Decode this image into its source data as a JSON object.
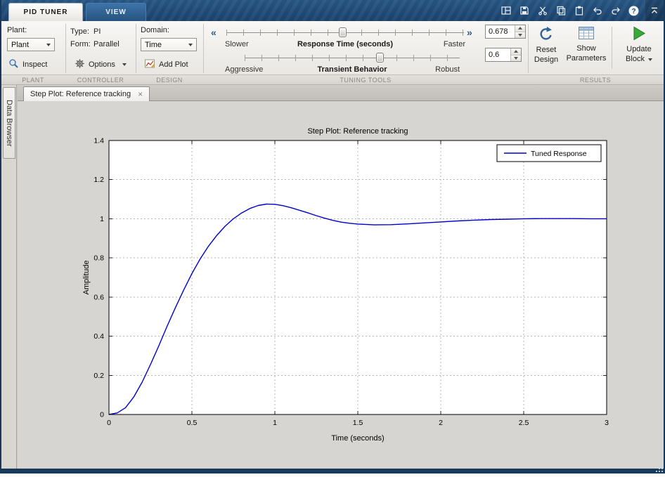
{
  "window": {
    "title_tabs": [
      {
        "label": "PID TUNER"
      },
      {
        "label": "VIEW"
      }
    ],
    "quick_access_icons": [
      "layout-grid-icon",
      "save-icon",
      "cut-icon",
      "copy-icon",
      "paste-icon",
      "undo-icon",
      "redo-icon",
      "help-icon"
    ],
    "collapse_ribbon_icon": "chevron-up-icon",
    "frame_color": "#16395c"
  },
  "ribbon": {
    "plant": {
      "section_label": "PLANT",
      "label": "Plant:",
      "dropdown_value": "Plant",
      "inspect_label": "Inspect"
    },
    "controller": {
      "section_label": "CONTROLLER",
      "type_label": "Type:",
      "type_value": "PI",
      "form_label": "Form:",
      "form_value": "Parallel",
      "options_label": "Options"
    },
    "design": {
      "section_label": "DESIGN",
      "domain_label": "Domain:",
      "domain_value": "Time",
      "add_plot_label": "Add Plot"
    },
    "tuning_tools": {
      "section_label": "TUNING TOOLS",
      "slower_chevron": "«",
      "faster_chevron": "»",
      "response_time": {
        "left": "Slower",
        "center": "Response Time (seconds)",
        "right": "Faster",
        "value": "0.678",
        "slider_percent": 49
      },
      "transient": {
        "left": "Aggressive",
        "center": "Transient Behavior",
        "right": "Robust",
        "value": "0.6",
        "slider_percent": 63
      }
    },
    "results": {
      "section_label": "RESULTS",
      "reset_design": {
        "line1": "Reset",
        "line2": "Design"
      },
      "show_parameters": {
        "line1": "Show",
        "line2": "Parameters"
      },
      "update_block": {
        "line1": "Update",
        "line2": "Block"
      }
    }
  },
  "sidebar": {
    "label": "Data Browser"
  },
  "document": {
    "tab_label": "Step Plot: Reference tracking",
    "close_icon": "×"
  },
  "chart_data": {
    "type": "line",
    "title": "Step Plot: Reference tracking",
    "xlabel": "Time (seconds)",
    "ylabel": "Amplitude",
    "xlim": [
      0,
      3
    ],
    "ylim": [
      0,
      1.4
    ],
    "xticks": [
      0,
      0.5,
      1,
      1.5,
      2,
      2.5,
      3
    ],
    "yticks": [
      0,
      0.2,
      0.4,
      0.6,
      0.8,
      1,
      1.2,
      1.4
    ],
    "grid": true,
    "legend": {
      "entries": [
        "Tuned Response"
      ],
      "position": "top-right"
    },
    "series": [
      {
        "name": "Tuned Response",
        "color": "#0000CC",
        "x": [
          0,
          0.05,
          0.1,
          0.15,
          0.2,
          0.25,
          0.3,
          0.35,
          0.4,
          0.45,
          0.5,
          0.55,
          0.6,
          0.65,
          0.7,
          0.75,
          0.8,
          0.85,
          0.9,
          0.95,
          1.0,
          1.05,
          1.1,
          1.15,
          1.2,
          1.25,
          1.3,
          1.35,
          1.4,
          1.45,
          1.5,
          1.6,
          1.7,
          1.8,
          1.9,
          2.0,
          2.1,
          2.2,
          2.3,
          2.4,
          2.5,
          2.6,
          2.7,
          2.8,
          2.9,
          3.0
        ],
        "y": [
          0,
          0.008,
          0.035,
          0.09,
          0.165,
          0.255,
          0.35,
          0.45,
          0.545,
          0.635,
          0.72,
          0.795,
          0.86,
          0.915,
          0.962,
          1.0,
          1.03,
          1.053,
          1.068,
          1.075,
          1.074,
          1.067,
          1.056,
          1.043,
          1.03,
          1.016,
          1.003,
          0.992,
          0.983,
          0.977,
          0.973,
          0.969,
          0.97,
          0.974,
          0.979,
          0.984,
          0.989,
          0.993,
          0.996,
          0.998,
          1.0,
          1.001,
          1.001,
          1.001,
          1.0,
          1.0
        ]
      }
    ]
  }
}
